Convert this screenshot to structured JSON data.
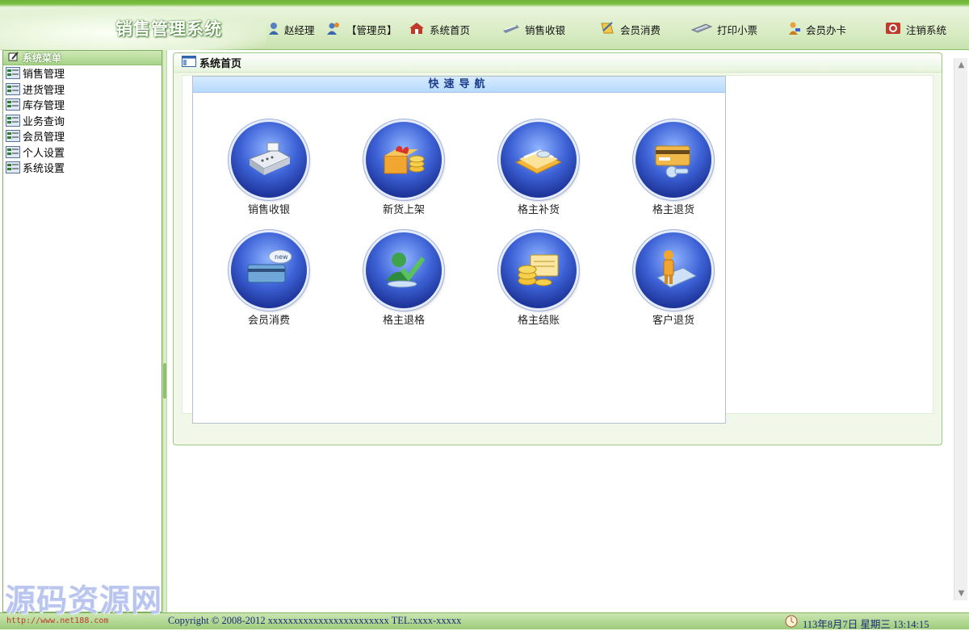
{
  "header": {
    "app_title": "销售管理系统",
    "user": "赵经理",
    "role": "【管理员】",
    "nav": [
      {
        "label": "系统首页",
        "icon": "home-icon"
      },
      {
        "label": "销售收银",
        "icon": "cash-register-icon"
      },
      {
        "label": "会员消费",
        "icon": "member-consume-icon"
      },
      {
        "label": "打印小票",
        "icon": "print-icon"
      },
      {
        "label": "会员办卡",
        "icon": "member-card-icon"
      },
      {
        "label": "注销系统",
        "icon": "logout-icon"
      }
    ]
  },
  "sidebar": {
    "title": "系统菜单",
    "items": [
      {
        "label": "销售管理"
      },
      {
        "label": "进货管理"
      },
      {
        "label": "库存管理"
      },
      {
        "label": "业务查询"
      },
      {
        "label": "会员管理"
      },
      {
        "label": "个人设置"
      },
      {
        "label": "系统设置"
      }
    ]
  },
  "main": {
    "panel_title": "系统首页",
    "quick_nav_title": "快速导航",
    "tiles": [
      {
        "label": "销售收银",
        "icon": "cash-register-icon"
      },
      {
        "label": "新货上架",
        "icon": "new-goods-icon"
      },
      {
        "label": "格主补货",
        "icon": "restock-icon"
      },
      {
        "label": "格主退货",
        "icon": "return-goods-icon"
      },
      {
        "label": "会员消费",
        "icon": "member-card-icon"
      },
      {
        "label": "格主退格",
        "icon": "user-check-icon"
      },
      {
        "label": "格主结账",
        "icon": "coins-checkout-icon"
      },
      {
        "label": "客户退货",
        "icon": "customer-return-icon"
      }
    ]
  },
  "footer": {
    "url": "http://www.net188.com",
    "copyright": "Copyright © 2008-2012 xxxxxxxxxxxxxxxxxxxxxxxx TEL:xxxx-xxxxx",
    "datetime": "113年8月7日 星期三 13:14:15"
  },
  "watermark": "源码资源网",
  "colors": {
    "accent_green": "#7ec045",
    "orb_blue": "#3d62d6",
    "footer_text": "#1c2a7a"
  }
}
